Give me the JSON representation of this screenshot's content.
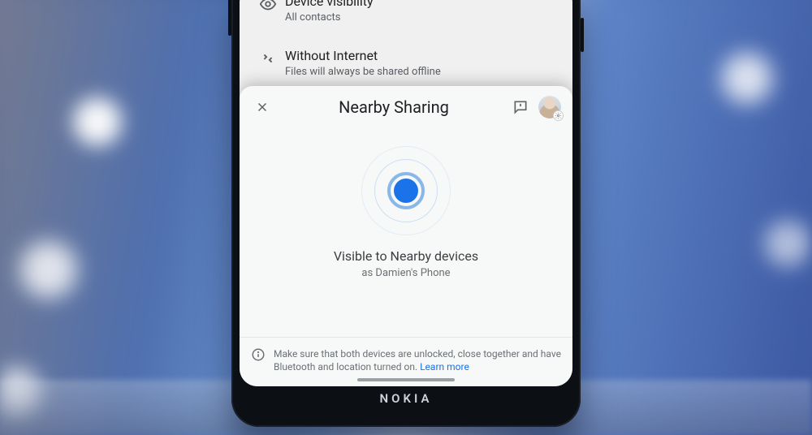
{
  "phone_brand": "NOKIA",
  "settings": {
    "rows": [
      {
        "icon": "eye",
        "title": "Device visibility",
        "subtitle": "All contacts"
      },
      {
        "icon": "offline",
        "title": "Without Internet",
        "subtitle": "Files will always be shared offline"
      }
    ]
  },
  "sheet": {
    "title": "Nearby Sharing",
    "status_line1": "Visible to Nearby devices",
    "status_line2": "as Damien's Phone",
    "hint_text": "Make sure that both devices are unlocked, close together and have Bluetooth and location turned on. ",
    "hint_link": "Learn more"
  }
}
